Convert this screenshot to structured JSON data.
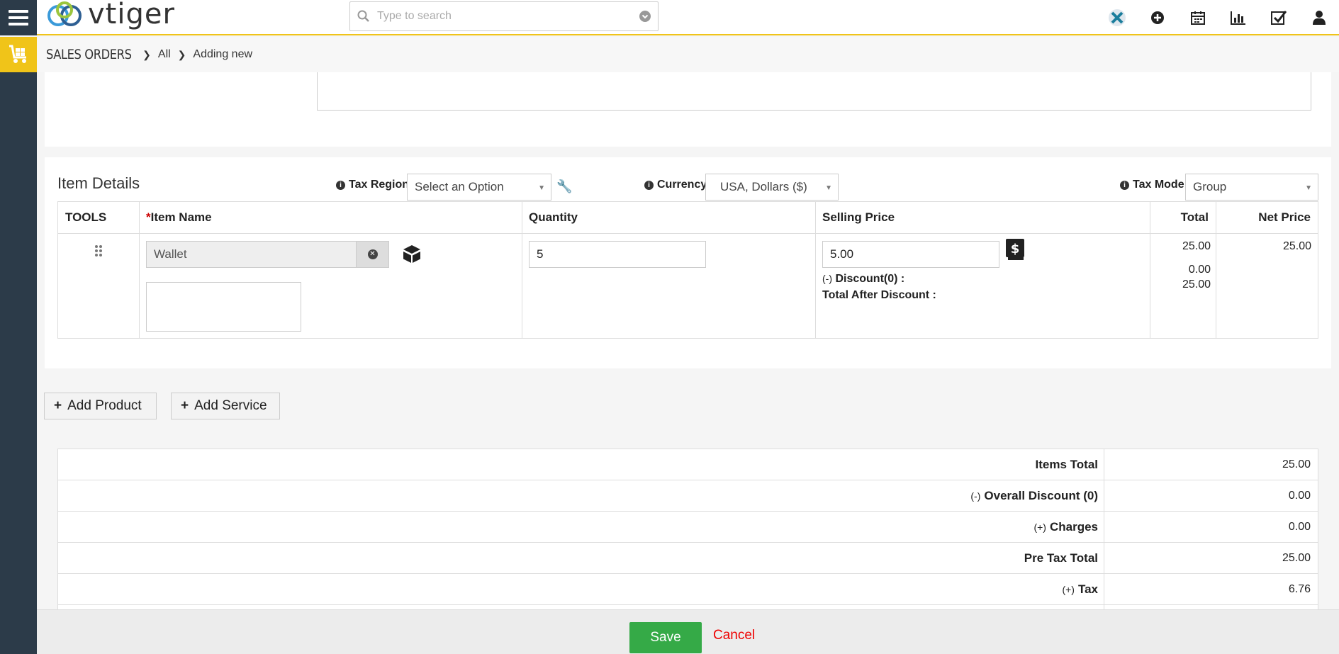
{
  "header": {
    "logo_text": "vtiger",
    "search_placeholder": "Type to search"
  },
  "breadcrumb": {
    "module": "SALES ORDERS",
    "all": "All",
    "current": "Adding new"
  },
  "item_details": {
    "title": "Item Details",
    "tax_region_label": "Tax Region",
    "tax_region_value": "Select an Option",
    "currency_label": "Currency",
    "currency_value": "USA, Dollars ($)",
    "tax_mode_label": "Tax Mode",
    "tax_mode_value": "Group",
    "columns": {
      "tools": "TOOLS",
      "item_name": "Item Name",
      "quantity": "Quantity",
      "selling_price": "Selling Price",
      "total": "Total",
      "net_price": "Net Price"
    },
    "row": {
      "item_name": "Wallet",
      "quantity": "5",
      "selling_price": "5.00",
      "discount_prefix": "(-)",
      "discount_label": "Discount(0) :",
      "total_after_discount_label": "Total After Discount :",
      "total": "25.00",
      "discount_value": "0.00",
      "total_after_discount": "25.00",
      "net_price": "25.00"
    }
  },
  "buttons": {
    "add_product": "Add Product",
    "add_service": "Add Service",
    "save": "Save",
    "cancel": "Cancel"
  },
  "totals": [
    {
      "prefix": "",
      "label": "Items Total",
      "value": "25.00"
    },
    {
      "prefix": "(-)",
      "label": "Overall Discount (0)",
      "value": "0.00"
    },
    {
      "prefix": "(+)",
      "label": "Charges",
      "value": "0.00"
    },
    {
      "prefix": "",
      "label": "Pre Tax Total",
      "value": "25.00"
    },
    {
      "prefix": "(+)",
      "label": "Tax",
      "value": "6.76"
    }
  ]
}
